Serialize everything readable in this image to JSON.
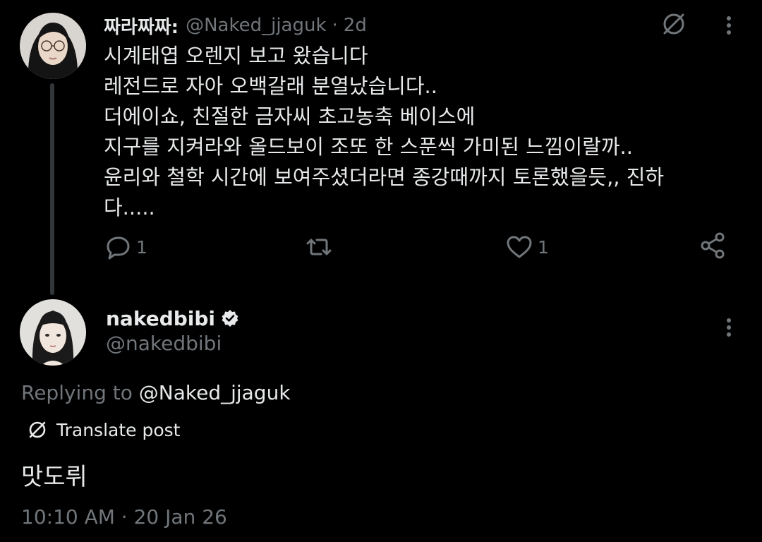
{
  "parent_tweet": {
    "display_name": "짜라짜짜:",
    "handle": "@Naked_jjaguk",
    "separator": "·",
    "time": "2d",
    "lines": [
      "시계태엽 오렌지 보고 왔습니다",
      "레전드로 자아 오백갈래 분열났습니다..",
      "더에이쇼, 친절한 금자씨 초고농축 베이스에",
      "지구를 지켜라와 올드보이 조또 한 스푼씩 가미된 느낌이랄까..",
      "윤리와 철학 시간에 보여주셨더라면 종강때까지 토론했을듯,, 진하",
      "다....."
    ],
    "actions": {
      "reply_count": "1",
      "like_count": "1"
    },
    "icons": [
      "translate-icon",
      "more-icon",
      "reply-icon",
      "repost-icon",
      "like-icon",
      "share-icon"
    ]
  },
  "reply_tweet": {
    "display_name": "nakedbibi",
    "handle": "@nakedbibi",
    "replying_prefix": "Replying to",
    "replying_handle": "@Naked_jjaguk",
    "translate_label": "Translate post",
    "text": "맛도뤼",
    "meta": "10:10 AM · 20 Jan 26",
    "icons": [
      "verified-badge-icon",
      "more-icon",
      "translate-icon"
    ]
  },
  "colors": {
    "background": "#000000",
    "primary_text": "#e7e9ea",
    "secondary_text": "#71767b",
    "thread_line": "#333639",
    "verified_badge": "#e7e9ea"
  }
}
